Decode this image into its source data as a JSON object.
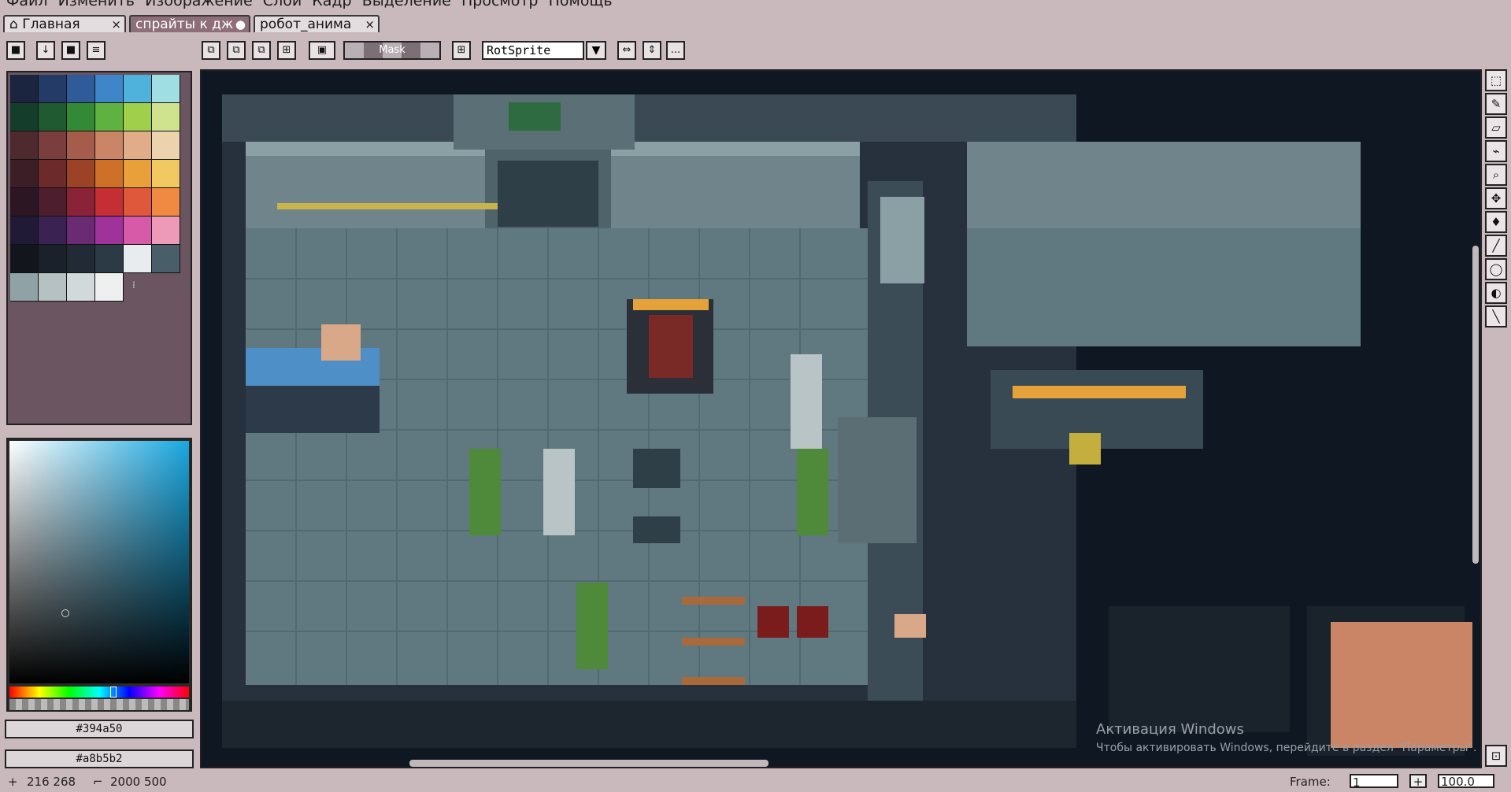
{
  "menu": [
    "Файл",
    "Изменить",
    "Изображение",
    "Слои",
    "Кадр",
    "Выделение",
    "Просмотр",
    "Помощь"
  ],
  "tabs": [
    {
      "label": "Главная",
      "close": "×"
    },
    {
      "label": "спрайты к дж",
      "close": "●"
    },
    {
      "label": "робот_анима",
      "close": "×"
    }
  ],
  "toolbar": {
    "mask_label": "Mask",
    "algorithm": "RotSprite",
    "more": "..."
  },
  "palette": {
    "colors": [
      [
        "#1b2540",
        "#233b66",
        "#2f5b98",
        "#3e86c8",
        "#4fb2dc",
        "#9fdfe4"
      ],
      [
        "#153d2c",
        "#1f5a30",
        "#338a36",
        "#5fb240",
        "#9fcf4b",
        "#cfe38f"
      ],
      [
        "#4e2a2e",
        "#7a3e3e",
        "#a65c4a",
        "#c98566",
        "#e0ad88",
        "#ecd2ad"
      ],
      [
        "#3c1f26",
        "#6c2a2a",
        "#9c4226",
        "#cf7028",
        "#e9a03a",
        "#f2c860"
      ],
      [
        "#2c1624",
        "#4c1e2e",
        "#8a2238",
        "#c42e34",
        "#e0583c",
        "#f08a42"
      ],
      [
        "#201a36",
        "#3a2352",
        "#6a2a74",
        "#a0329c",
        "#d65aa8",
        "#ec9ab8"
      ],
      [
        "#12151c",
        "#1b212b",
        "#222a36",
        "#2c3a46",
        "#e9ecef",
        "#4a5e6a"
      ],
      [
        "#8fa3a6",
        "#b5c1c3",
        "#d2d9da",
        "#eef0f0"
      ]
    ]
  },
  "color_picker": {
    "primary_hex": "#394a50",
    "secondary_hex": "#a8b5b2"
  },
  "status": {
    "cursor": "216 268",
    "canvas_size": "2000 500",
    "frame_label": "Frame:",
    "frame_value": "1",
    "zoom": "100.0"
  },
  "watermark": {
    "title": "Активация Windows",
    "subtitle": "Чтобы активировать Windows, перейдите в раздел \"Параметры\"."
  }
}
